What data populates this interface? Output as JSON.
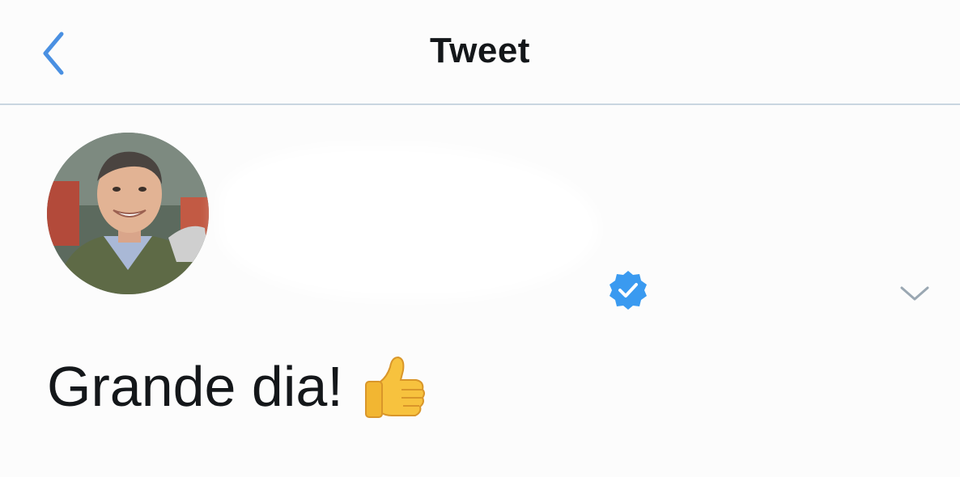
{
  "header": {
    "title": "Tweet",
    "back_icon": "chevron-left-icon",
    "accent_color": "#4a90e2"
  },
  "tweet": {
    "verified_icon": "verified-badge-icon",
    "menu_icon": "chevron-down-icon",
    "text": "Grande dia!",
    "emoji": "thumbs-up-emoji"
  },
  "colors": {
    "background": "#fcfcfc",
    "text": "#14171a",
    "divider": "#c9d6e0",
    "verified": "#3a9af0",
    "caret": "#9aa7b2"
  }
}
